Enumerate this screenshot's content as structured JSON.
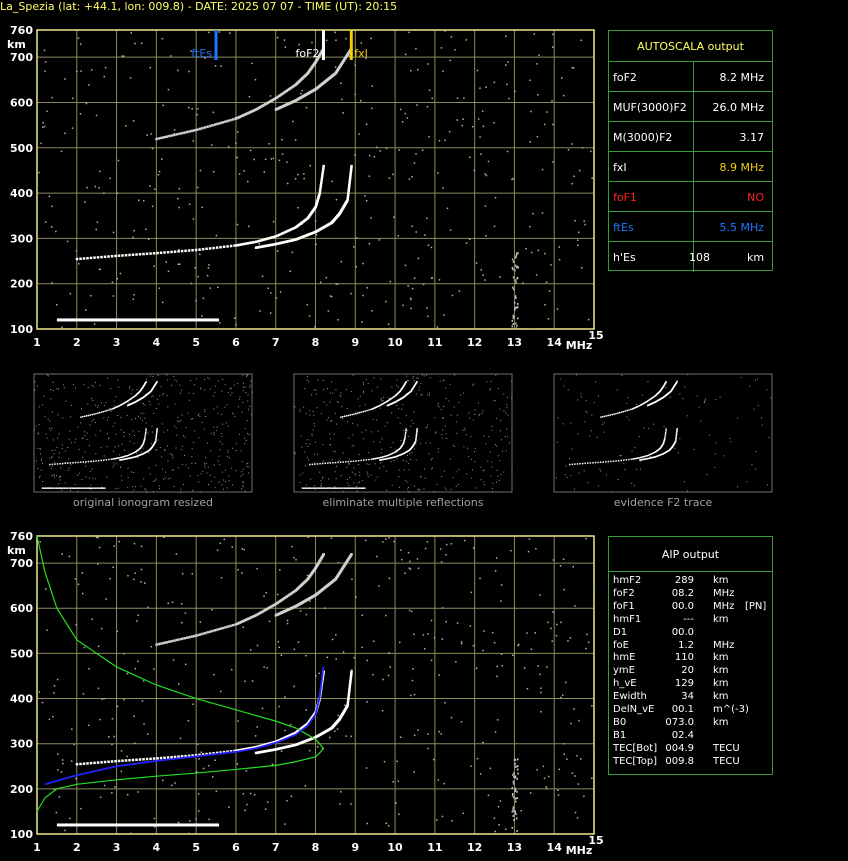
{
  "header": {
    "title": "La_Spezia (lat: +44.1, lon: 009.8) - DATE: 2025 07 07 - TIME (UT): 20:15"
  },
  "colors": {
    "grid": "#8a8a5a",
    "frame": "#f0e68c",
    "table_border": "#3a9a3a",
    "ftes": "#1e78ff",
    "fof2": "#ffffff",
    "fxi": "#f0d000",
    "nh_profile": "#22dd22",
    "fit_trace": "#2222ff",
    "no_value": "#ff2020"
  },
  "autoscala": {
    "title": "AUTOSCALA output",
    "rows": [
      {
        "label": "foF2",
        "value": "8.2 MHz",
        "label_color": "#ffffff",
        "value_color": "#ffffff"
      },
      {
        "label": "MUF(3000)F2",
        "value": "26.0 MHz",
        "label_color": "#ffffff",
        "value_color": "#ffffff"
      },
      {
        "label": "M(3000)F2",
        "value": "3.17",
        "label_color": "#ffffff",
        "value_color": "#ffffff"
      },
      {
        "label": "fxI",
        "value": "8.9 MHz",
        "label_color": "#ffffff",
        "value_color": "#f0d000"
      },
      {
        "label": "foF1",
        "value": "NO",
        "label_color": "#ff2020",
        "value_color": "#ff2020"
      },
      {
        "label": "ftEs",
        "value": "5.5 MHz",
        "label_color": "#1e78ff",
        "value_color": "#1e78ff"
      },
      {
        "label": "h'Es",
        "value": "108",
        "unit": "km",
        "label_color": "#ffffff",
        "value_color": "#ffffff"
      }
    ]
  },
  "aip": {
    "title": "AIP output",
    "rows": [
      {
        "name": "hmF2",
        "value": "289",
        "unit": "km",
        "extra": ""
      },
      {
        "name": "foF2",
        "value": "08.2",
        "unit": "MHz",
        "extra": ""
      },
      {
        "name": "foF1",
        "value": "00.0",
        "unit": "MHz",
        "extra": "[PN]"
      },
      {
        "name": "hmF1",
        "value": "---",
        "unit": "km",
        "extra": ""
      },
      {
        "name": "D1",
        "value": "00.0",
        "unit": "",
        "extra": ""
      },
      {
        "name": "foE",
        "value": "1.2",
        "unit": "MHz",
        "extra": ""
      },
      {
        "name": "hmE",
        "value": "110",
        "unit": "km",
        "extra": ""
      },
      {
        "name": "ymE",
        "value": "20",
        "unit": "km",
        "extra": ""
      },
      {
        "name": "h_vE",
        "value": "129",
        "unit": "km",
        "extra": ""
      },
      {
        "name": "Ewidth",
        "value": "34",
        "unit": "km",
        "extra": ""
      },
      {
        "name": "DelN_vE",
        "value": "00.1",
        "unit": "m^(-3)",
        "extra": ""
      },
      {
        "name": "B0",
        "value": "073.0",
        "unit": "km",
        "extra": ""
      },
      {
        "name": "B1",
        "value": "02.4",
        "unit": "",
        "extra": ""
      },
      {
        "name": "TEC[Bot]",
        "value": "004.9",
        "unit": "TECU",
        "extra": ""
      },
      {
        "name": "TEC[Top]",
        "value": "009.8",
        "unit": "TECU",
        "extra": ""
      }
    ]
  },
  "thumbnails": [
    {
      "caption": "original ionogram resized"
    },
    {
      "caption": "eliminate multiple reflections"
    },
    {
      "caption": "evidence F2 trace"
    }
  ],
  "chart_data": [
    {
      "type": "scatter",
      "name": "ionogram",
      "xlabel": "MHz",
      "ylabel": "km",
      "xlim": [
        1,
        15
      ],
      "ylim": [
        100,
        760
      ],
      "x_ticks": [
        1,
        2,
        3,
        4,
        5,
        6,
        7,
        8,
        9,
        10,
        11,
        12,
        13,
        14,
        15
      ],
      "y_ticks": [
        100,
        200,
        300,
        400,
        500,
        600,
        700,
        760
      ],
      "grid": true,
      "markers": [
        {
          "label": "ftEs",
          "x": 5.5,
          "color": "#1e78ff"
        },
        {
          "label": "foF2",
          "x": 8.2,
          "color": "#ffffff"
        },
        {
          "label": "fxI",
          "x": 8.9,
          "color": "#f0d000"
        }
      ],
      "traces": {
        "Es": {
          "x": [
            1.5,
            5.5
          ],
          "y": 120
        },
        "O_F2": {
          "x": [
            2.0,
            3.0,
            4.0,
            5.0,
            6.0,
            6.5,
            7.0,
            7.5,
            7.8,
            8.0,
            8.1,
            8.2
          ],
          "y": [
            255,
            262,
            268,
            275,
            285,
            293,
            305,
            325,
            345,
            370,
            400,
            460
          ]
        },
        "X_F2": {
          "x": [
            6.5,
            7.0,
            7.5,
            8.0,
            8.4,
            8.6,
            8.8,
            8.9
          ],
          "y": [
            280,
            288,
            298,
            315,
            335,
            355,
            385,
            460
          ]
        },
        "O_F2_2nd": {
          "x": [
            4.0,
            5.0,
            6.0,
            6.5,
            7.0,
            7.5,
            7.8,
            8.0,
            8.2
          ],
          "y": [
            520,
            540,
            565,
            585,
            610,
            640,
            665,
            690,
            720
          ]
        },
        "X_F2_2nd": {
          "x": [
            7.0,
            7.5,
            8.0,
            8.5,
            8.9
          ],
          "y": [
            585,
            605,
            630,
            665,
            720
          ]
        }
      }
    },
    {
      "type": "line",
      "name": "aip_profile",
      "xlabel": "MHz",
      "ylabel": "km",
      "xlim": [
        1,
        15
      ],
      "ylim": [
        100,
        760
      ],
      "x_ticks": [
        1,
        2,
        3,
        4,
        5,
        6,
        7,
        8,
        9,
        10,
        11,
        12,
        13,
        14,
        15
      ],
      "y_ticks": [
        100,
        200,
        300,
        400,
        500,
        600,
        700,
        760
      ],
      "grid": true,
      "series": [
        {
          "x": [
            1.0,
            1.2,
            1.5,
            2.0,
            3.0,
            4.0,
            5.0,
            6.0,
            7.0,
            7.5,
            7.8,
            8.0,
            8.1,
            8.2,
            8.1,
            8.0,
            7.5,
            7.0,
            6.0,
            5.0,
            4.0,
            3.0,
            2.0,
            1.5,
            1.2,
            1.0
          ],
          "y": [
            760,
            680,
            600,
            530,
            470,
            430,
            400,
            375,
            350,
            335,
            320,
            310,
            300,
            289,
            279,
            271,
            260,
            252,
            243,
            235,
            228,
            220,
            210,
            200,
            180,
            150
          ],
          "color": "#22dd22"
        },
        {
          "x": [
            1.2,
            1.5,
            2.0,
            3.0,
            4.0,
            5.0,
            6.0,
            6.5,
            7.0,
            7.5,
            7.8,
            8.0,
            8.1,
            8.2
          ],
          "y": [
            210,
            218,
            230,
            250,
            262,
            272,
            282,
            290,
            302,
            320,
            340,
            365,
            400,
            470
          ],
          "color": "#2222ff"
        }
      ]
    }
  ]
}
